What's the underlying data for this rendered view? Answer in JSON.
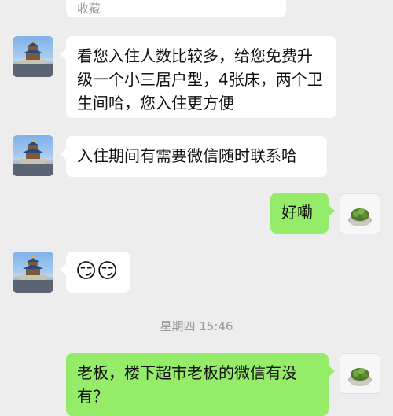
{
  "messages": [
    {
      "sender": "other",
      "text": "收藏"
    },
    {
      "sender": "other",
      "text": "看您入住人数比较多，给您免费升级一个小三居户型，4张床，两个卫生间哈，您入住更方便"
    },
    {
      "sender": "other",
      "text": "入住期间有需要微信随时联系哈"
    },
    {
      "sender": "self",
      "text": "好嘞"
    },
    {
      "sender": "other",
      "text": "😏😏"
    },
    {
      "sender": "self",
      "text": "老板，楼下超市老板的微信有没有？"
    }
  ],
  "timestamp": "星期四 15:46",
  "avatars": {
    "other": "temple-of-heaven-photo",
    "self": "green-plant-in-pot-icon"
  }
}
